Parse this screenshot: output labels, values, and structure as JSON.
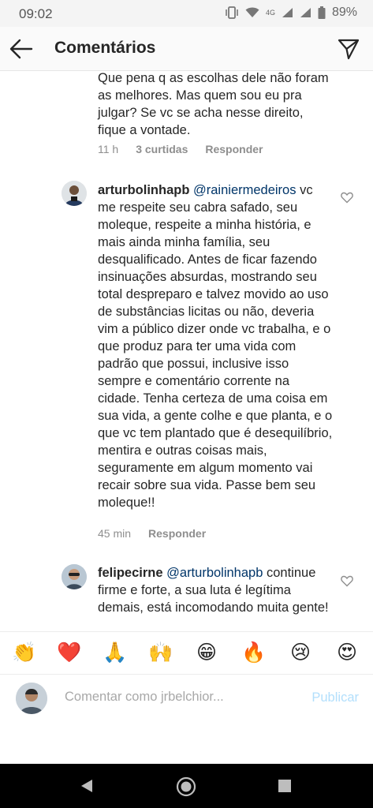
{
  "status_bar": {
    "time": "09:02",
    "network": "4G",
    "battery": "89%"
  },
  "header": {
    "title": "Comentários",
    "back_icon": "arrow-left-icon",
    "send_icon": "paper-plane-icon"
  },
  "previous_comment": {
    "text": "Que pena q as escolhas dele não foram as melhores. Mas quem sou eu pra julgar? Se vc se acha nesse direito, fique a vontade.",
    "time": "11 h",
    "likes": "3 curtidas",
    "reply": "Responder"
  },
  "comments": [
    {
      "username": "arturbolinhapb",
      "mention": "@rainiermedeiros",
      "text": "vc me respeite seu cabra safado, seu moleque, respeite a minha história, e mais ainda minha família, seu desqualificado. Antes de ficar fazendo insinuações absurdas, mostrando seu total despreparo e talvez movido ao uso de substâncias licitas ou não, deveria vim a público dizer onde vc trabalha, e o que produz para ter uma vida com padrão que possui, inclusive isso sempre e comentário corrente na cidade. Tenha certeza de uma coisa em sua vida, a gente colhe e que planta, e o que vc tem plantado que é desequilíbrio, mentira e outras coisas mais, seguramente em algum momento vai recair sobre sua vida. Passe bem seu moleque!!",
      "time": "45 min",
      "reply": "Responder"
    },
    {
      "username": "felipecirne",
      "mention": "@arturbolinhapb",
      "text": "continue firme e forte, a sua luta é legítima demais, está incomodando muita gente!"
    }
  ],
  "emoji_bar": [
    "👏",
    "❤️",
    "🙏",
    "🙌",
    "😁",
    "🔥",
    "😢",
    "😍"
  ],
  "input": {
    "placeholder": "Comentar como jrbelchior...",
    "publish": "Publicar"
  },
  "colors": {
    "mention": "#003569",
    "meta": "#8e8e8e",
    "publish_disabled": "#b2dffc",
    "heart_red": "#ed4956"
  }
}
